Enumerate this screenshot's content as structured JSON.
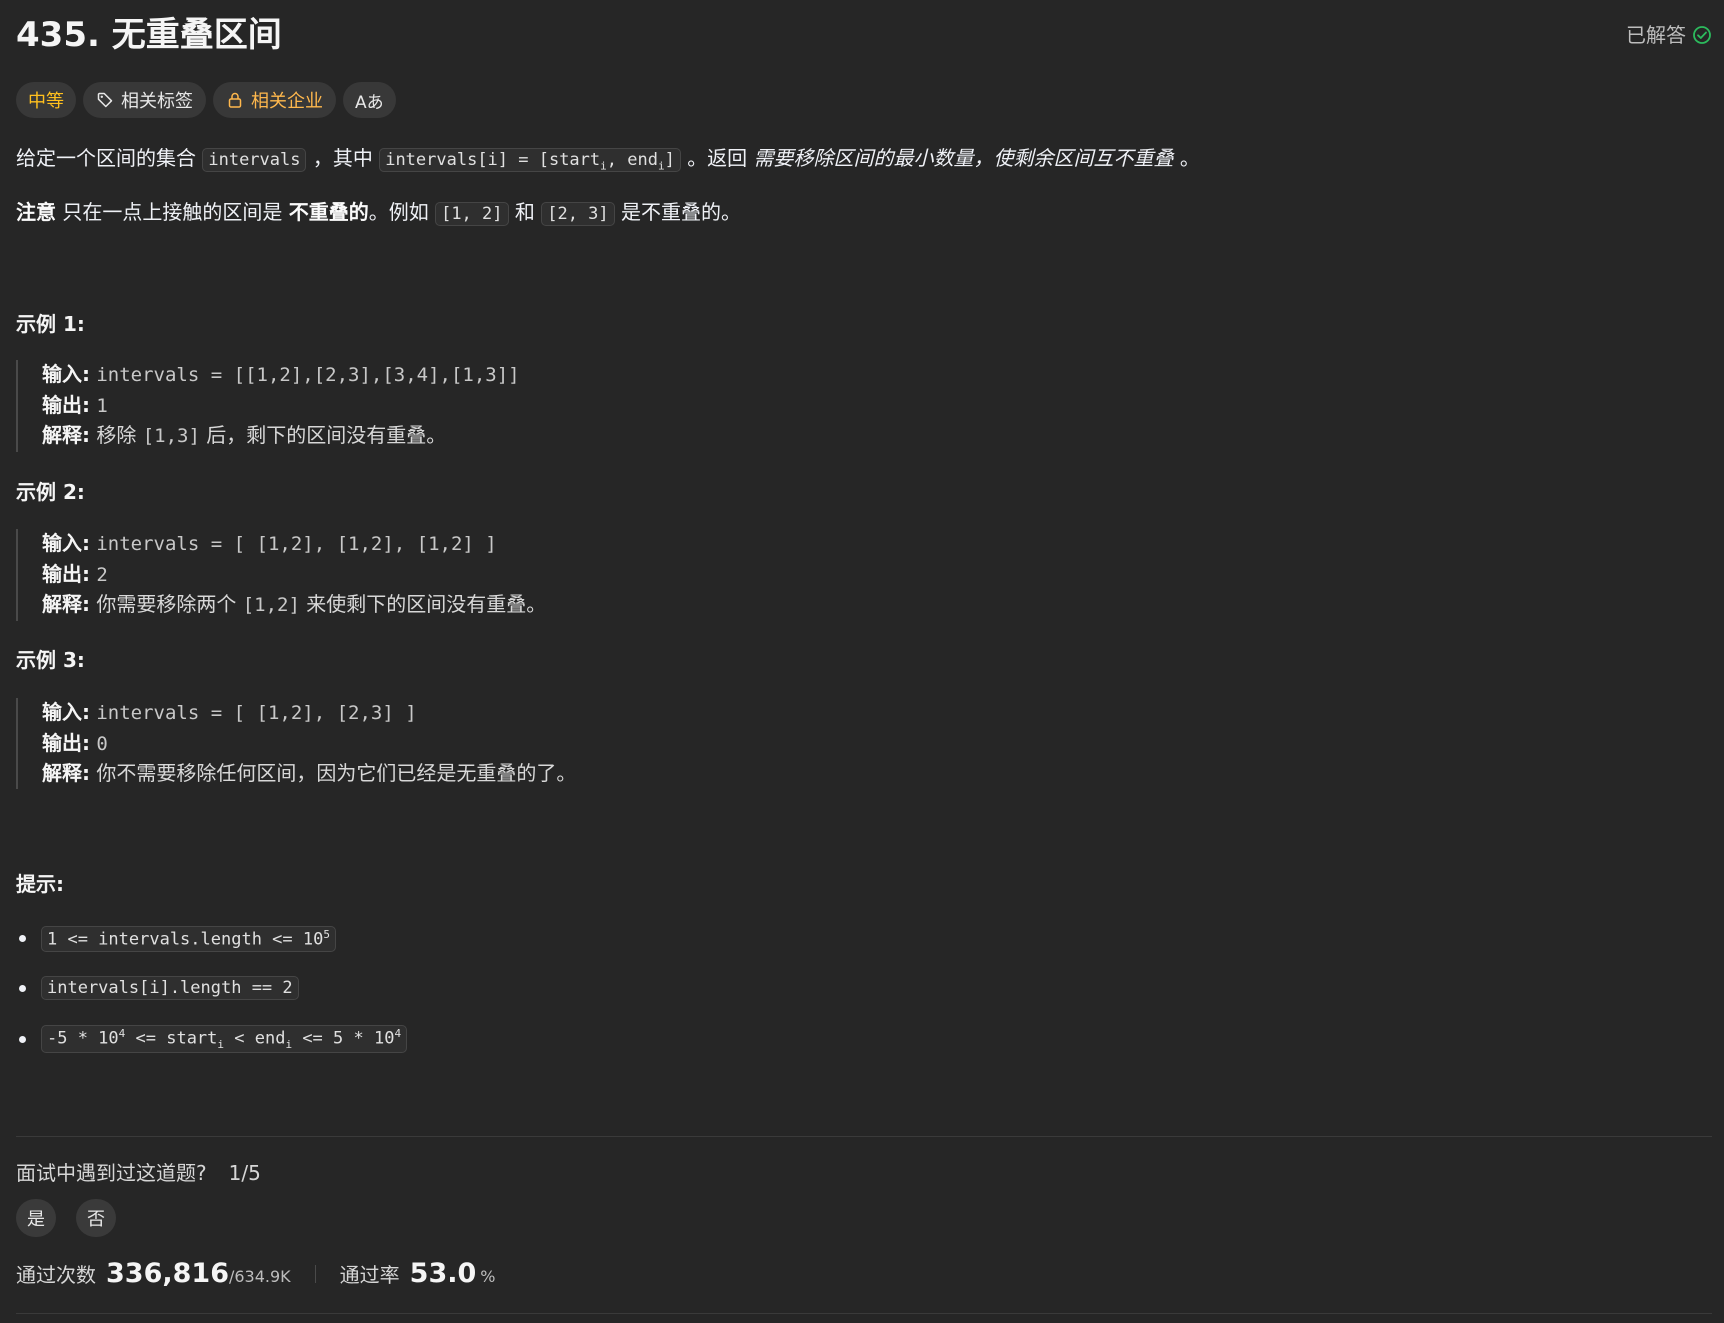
{
  "header": {
    "title": "435. 无重叠区间",
    "status": "已解答",
    "status_color": "#2cbb5d"
  },
  "tags": {
    "difficulty": "中等",
    "related_tags": "相关标签",
    "related_companies": "相关企业",
    "translate": "Aあ"
  },
  "description": {
    "p1_a": "给定一个区间的集合",
    "p1_code1": "intervals",
    "p1_b": "，其中",
    "p1_code2_a": "intervals[i] = [start",
    "p1_code2_sub1": "i",
    "p1_code2_b": ", end",
    "p1_code2_sub2": "i",
    "p1_code2_c": "]",
    "p1_c": "。返回",
    "p1_italic": "需要移除区间的最小数量，使剩余区间互不重叠",
    "p1_d": "。",
    "p2_bold": "注意",
    "p2_a": "只在一点上接触的区间是",
    "p2_bold2": "不重叠的",
    "p2_b": "。例如",
    "p2_code1": "[1, 2]",
    "p2_c": "和",
    "p2_code2": "[2, 3]",
    "p2_d": "是不重叠的。"
  },
  "examples": [
    {
      "title": "示例 1:",
      "input_label": "输入:",
      "input": "intervals = [[1,2],[2,3],[3,4],[1,3]]",
      "output_label": "输出:",
      "output": "1",
      "explain_label": "解释:",
      "explain_a": "移除",
      "explain_code": "[1,3]",
      "explain_b": "后，剩下的区间没有重叠。"
    },
    {
      "title": "示例 2:",
      "input_label": "输入:",
      "input": "intervals = [ [1,2], [1,2], [1,2] ]",
      "output_label": "输出:",
      "output": "2",
      "explain_label": "解释:",
      "explain_a": "你需要移除两个",
      "explain_code": "[1,2]",
      "explain_b": "来使剩下的区间没有重叠。"
    },
    {
      "title": "示例 3:",
      "input_label": "输入:",
      "input": "intervals = [ [1,2], [2,3] ]",
      "output_label": "输出:",
      "output": "0",
      "explain_label": "解释:",
      "explain_a": "你不需要移除任何区间，因为它们已经是无重叠的了。",
      "explain_code": "",
      "explain_b": ""
    }
  ],
  "hints": {
    "title": "提示:",
    "h1_a": "1 <= intervals.length <= 10",
    "h1_sup": "5",
    "h2": "intervals[i].length == 2",
    "h3_a": "-5 * 10",
    "h3_sup1": "4",
    "h3_b": " <= start",
    "h3_sub1": "i",
    "h3_c": " < end",
    "h3_sub2": "i",
    "h3_d": " <= 5 * 10",
    "h3_sup2": "4"
  },
  "footer": {
    "interview_question": "面试中遇到过这道题?",
    "interview_count": "1/5",
    "yes": "是",
    "no": "否",
    "accepted_label": "通过次数",
    "accepted_value": "336,816",
    "submissions": "/634.9K",
    "rate_label": "通过率",
    "rate_value": "53.0",
    "rate_unit": "%"
  }
}
